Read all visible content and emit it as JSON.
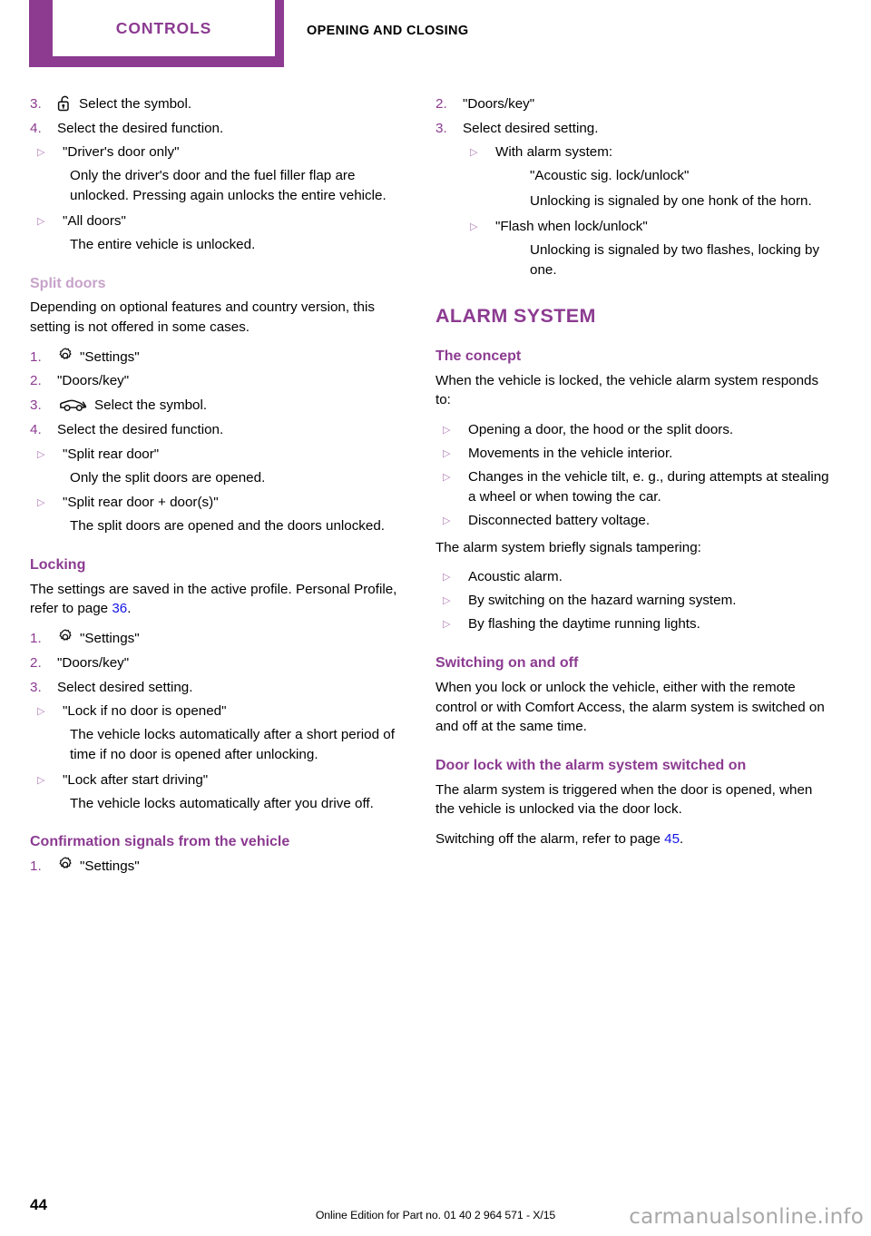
{
  "header": {
    "chapter_tab": "CONTROLS",
    "section_title": "OPENING AND CLOSING",
    "accent_color": "#8C3B91"
  },
  "left_column": {
    "continued_steps": [
      {
        "num": "3.",
        "icon": "unlocked-padlock-icon",
        "text": "Select the symbol."
      },
      {
        "num": "4.",
        "icon": null,
        "text": "Select the desired function."
      }
    ],
    "continued_bullets": [
      {
        "mark": "▷",
        "label": "\"Driver's door only\"",
        "body": "Only the driver's door and the fuel filler flap are unlocked. Pressing again unlocks the entire vehicle."
      },
      {
        "mark": "▷",
        "label": "\"All doors\"",
        "body": "The entire vehicle is unlocked."
      }
    ],
    "split_doors": {
      "heading": "Split doors",
      "intro": "Depending on optional features and country version, this setting is not offered in some cases.",
      "steps": [
        {
          "num": "1.",
          "icon": "gear-icon",
          "text": "\"Settings\""
        },
        {
          "num": "2.",
          "icon": null,
          "text": "\"Doors/key\""
        },
        {
          "num": "3.",
          "icon": "car-icon",
          "text": "Select the symbol."
        },
        {
          "num": "4.",
          "icon": null,
          "text": "Select the desired function."
        }
      ],
      "bullets": [
        {
          "mark": "▷",
          "label": "\"Split rear door\"",
          "body": "Only the split doors are opened."
        },
        {
          "mark": "▷",
          "label": "\"Split rear door + door(s)\"",
          "body": "The split doors are opened and the doors unlocked."
        }
      ]
    },
    "locking": {
      "heading": "Locking",
      "intro_before": "The settings are saved in the active profile. Personal Profile, refer to page ",
      "intro_pageref": "36",
      "intro_after": ".",
      "steps": [
        {
          "num": "1.",
          "icon": "gear-icon",
          "text": "\"Settings\""
        },
        {
          "num": "2.",
          "icon": null,
          "text": "\"Doors/key\""
        },
        {
          "num": "3.",
          "icon": null,
          "text": "Select desired setting."
        }
      ],
      "bullets": [
        {
          "mark": "▷",
          "label": "\"Lock if no door is opened\"",
          "body": "The vehicle locks automatically after a short period of time if no door is opened after unlocking."
        },
        {
          "mark": "▷",
          "label": "\"Lock after start driving\"",
          "body": "The vehicle locks automatically after you drive off."
        }
      ]
    },
    "confirmation_signals": {
      "heading": "Confirmation signals from the vehicle",
      "steps": [
        {
          "num": "1.",
          "icon": "gear-icon",
          "text": "\"Settings\""
        }
      ]
    }
  },
  "right_column": {
    "continued_steps": [
      {
        "num": "2.",
        "icon": null,
        "text": "\"Doors/key\""
      },
      {
        "num": "3.",
        "icon": null,
        "text": "Select desired setting."
      }
    ],
    "continued_bullets": [
      {
        "mark": "▷",
        "label": "With alarm system:",
        "sub_label": "\"Acoustic sig. lock/unlock\"",
        "body": "Unlocking is signaled by one honk of the horn."
      },
      {
        "mark": "▷",
        "label": "\"Flash when lock/unlock\"",
        "sub_label": null,
        "body": "Unlocking is signaled by two flashes, locking by one."
      }
    ],
    "alarm_system": {
      "heading": "ALARM SYSTEM",
      "concept": {
        "heading": "The concept",
        "intro": "When the vehicle is locked, the vehicle alarm system responds to:",
        "bullets": [
          "Opening a door, the hood or the split doors.",
          "Movements in the vehicle interior.",
          "Changes in the vehicle tilt, e. g., during attempts at stealing a wheel or when towing the car.",
          "Disconnected battery voltage."
        ],
        "tamper_intro": "The alarm system briefly signals tampering:",
        "tamper_bullets": [
          "Acoustic alarm.",
          "By switching on the hazard warning system.",
          "By flashing the daytime running lights."
        ]
      },
      "switching": {
        "heading": "Switching on and off",
        "body": "When you lock or unlock the vehicle, either with the remote control or with Comfort Access, the alarm system is switched on and off at the same time."
      },
      "door_lock": {
        "heading": "Door lock with the alarm system switched on",
        "body": "The alarm system is triggered when the door is opened, when the vehicle is unlocked via the door lock.",
        "ref_before": "Switching off the alarm, refer to page ",
        "ref_page": "45",
        "ref_after": "."
      }
    }
  },
  "footer": {
    "page_number": "44",
    "edition_line": "Online Edition for Part no. 01 40 2 964 571 - X/15",
    "watermark": "carmanualsonline.info"
  }
}
